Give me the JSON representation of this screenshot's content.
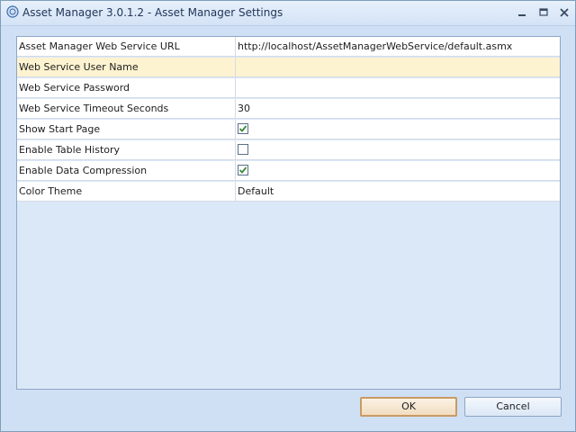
{
  "window": {
    "title": "Asset Manager 3.0.1.2 - Asset Manager Settings",
    "icon": "app-logo-icon",
    "controls": [
      "minimize-icon",
      "maximize-icon",
      "close-icon"
    ]
  },
  "settings": [
    {
      "name": "Asset Manager Web Service URL",
      "value": "http://localhost/AssetManagerWebService/default.asmx"
    },
    {
      "name": "Web Service User Name",
      "value": ""
    },
    {
      "name": "Web Service Password",
      "value": ""
    },
    {
      "name": "Web Service Timeout Seconds",
      "value": "30"
    },
    {
      "name": "Show Start Page",
      "checked": true
    },
    {
      "name": "Enable Table History",
      "checked": false
    },
    {
      "name": "Enable Data Compression",
      "checked": true
    },
    {
      "name": "Color Theme",
      "value": "Default"
    }
  ],
  "selected_row": 1,
  "buttons": {
    "ok": "OK",
    "cancel": "Cancel"
  },
  "colors": {
    "selected_row": "#fdf3d0",
    "ok_border": "#c89b62",
    "check": "#3a8a3a"
  }
}
